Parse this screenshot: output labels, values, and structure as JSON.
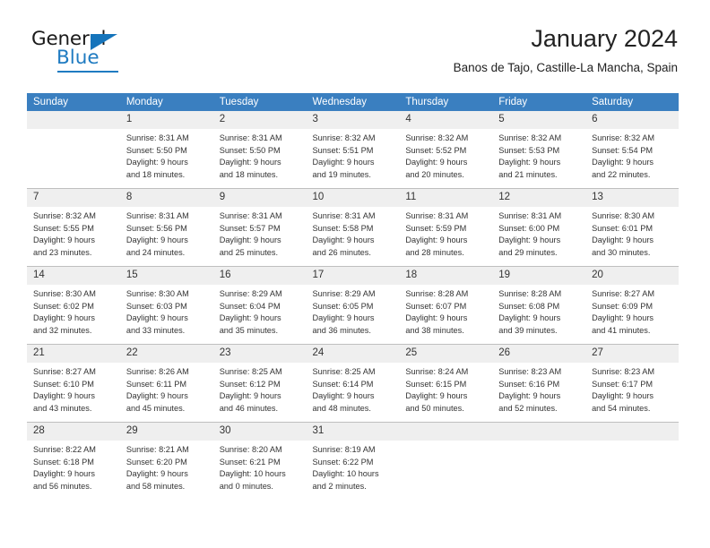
{
  "brand": {
    "name_dark": "General",
    "name_blue": "Blue",
    "accent_color": "#1f7bc1",
    "triangle_color": "#1574bb"
  },
  "header": {
    "title": "January 2024",
    "subtitle": "Banos de Tajo, Castille-La Mancha, Spain"
  },
  "calendar": {
    "header_bg": "#3a7fc0",
    "daynum_bg": "#efefef",
    "weekday_headers": [
      "Sunday",
      "Monday",
      "Tuesday",
      "Wednesday",
      "Thursday",
      "Friday",
      "Saturday"
    ],
    "weeks": [
      [
        {
          "day": "",
          "sunrise": "",
          "sunset": "",
          "daylight1": "",
          "daylight2": ""
        },
        {
          "day": "1",
          "sunrise": "Sunrise: 8:31 AM",
          "sunset": "Sunset: 5:50 PM",
          "daylight1": "Daylight: 9 hours",
          "daylight2": "and 18 minutes."
        },
        {
          "day": "2",
          "sunrise": "Sunrise: 8:31 AM",
          "sunset": "Sunset: 5:50 PM",
          "daylight1": "Daylight: 9 hours",
          "daylight2": "and 18 minutes."
        },
        {
          "day": "3",
          "sunrise": "Sunrise: 8:32 AM",
          "sunset": "Sunset: 5:51 PM",
          "daylight1": "Daylight: 9 hours",
          "daylight2": "and 19 minutes."
        },
        {
          "day": "4",
          "sunrise": "Sunrise: 8:32 AM",
          "sunset": "Sunset: 5:52 PM",
          "daylight1": "Daylight: 9 hours",
          "daylight2": "and 20 minutes."
        },
        {
          "day": "5",
          "sunrise": "Sunrise: 8:32 AM",
          "sunset": "Sunset: 5:53 PM",
          "daylight1": "Daylight: 9 hours",
          "daylight2": "and 21 minutes."
        },
        {
          "day": "6",
          "sunrise": "Sunrise: 8:32 AM",
          "sunset": "Sunset: 5:54 PM",
          "daylight1": "Daylight: 9 hours",
          "daylight2": "and 22 minutes."
        }
      ],
      [
        {
          "day": "7",
          "sunrise": "Sunrise: 8:32 AM",
          "sunset": "Sunset: 5:55 PM",
          "daylight1": "Daylight: 9 hours",
          "daylight2": "and 23 minutes."
        },
        {
          "day": "8",
          "sunrise": "Sunrise: 8:31 AM",
          "sunset": "Sunset: 5:56 PM",
          "daylight1": "Daylight: 9 hours",
          "daylight2": "and 24 minutes."
        },
        {
          "day": "9",
          "sunrise": "Sunrise: 8:31 AM",
          "sunset": "Sunset: 5:57 PM",
          "daylight1": "Daylight: 9 hours",
          "daylight2": "and 25 minutes."
        },
        {
          "day": "10",
          "sunrise": "Sunrise: 8:31 AM",
          "sunset": "Sunset: 5:58 PM",
          "daylight1": "Daylight: 9 hours",
          "daylight2": "and 26 minutes."
        },
        {
          "day": "11",
          "sunrise": "Sunrise: 8:31 AM",
          "sunset": "Sunset: 5:59 PM",
          "daylight1": "Daylight: 9 hours",
          "daylight2": "and 28 minutes."
        },
        {
          "day": "12",
          "sunrise": "Sunrise: 8:31 AM",
          "sunset": "Sunset: 6:00 PM",
          "daylight1": "Daylight: 9 hours",
          "daylight2": "and 29 minutes."
        },
        {
          "day": "13",
          "sunrise": "Sunrise: 8:30 AM",
          "sunset": "Sunset: 6:01 PM",
          "daylight1": "Daylight: 9 hours",
          "daylight2": "and 30 minutes."
        }
      ],
      [
        {
          "day": "14",
          "sunrise": "Sunrise: 8:30 AM",
          "sunset": "Sunset: 6:02 PM",
          "daylight1": "Daylight: 9 hours",
          "daylight2": "and 32 minutes."
        },
        {
          "day": "15",
          "sunrise": "Sunrise: 8:30 AM",
          "sunset": "Sunset: 6:03 PM",
          "daylight1": "Daylight: 9 hours",
          "daylight2": "and 33 minutes."
        },
        {
          "day": "16",
          "sunrise": "Sunrise: 8:29 AM",
          "sunset": "Sunset: 6:04 PM",
          "daylight1": "Daylight: 9 hours",
          "daylight2": "and 35 minutes."
        },
        {
          "day": "17",
          "sunrise": "Sunrise: 8:29 AM",
          "sunset": "Sunset: 6:05 PM",
          "daylight1": "Daylight: 9 hours",
          "daylight2": "and 36 minutes."
        },
        {
          "day": "18",
          "sunrise": "Sunrise: 8:28 AM",
          "sunset": "Sunset: 6:07 PM",
          "daylight1": "Daylight: 9 hours",
          "daylight2": "and 38 minutes."
        },
        {
          "day": "19",
          "sunrise": "Sunrise: 8:28 AM",
          "sunset": "Sunset: 6:08 PM",
          "daylight1": "Daylight: 9 hours",
          "daylight2": "and 39 minutes."
        },
        {
          "day": "20",
          "sunrise": "Sunrise: 8:27 AM",
          "sunset": "Sunset: 6:09 PM",
          "daylight1": "Daylight: 9 hours",
          "daylight2": "and 41 minutes."
        }
      ],
      [
        {
          "day": "21",
          "sunrise": "Sunrise: 8:27 AM",
          "sunset": "Sunset: 6:10 PM",
          "daylight1": "Daylight: 9 hours",
          "daylight2": "and 43 minutes."
        },
        {
          "day": "22",
          "sunrise": "Sunrise: 8:26 AM",
          "sunset": "Sunset: 6:11 PM",
          "daylight1": "Daylight: 9 hours",
          "daylight2": "and 45 minutes."
        },
        {
          "day": "23",
          "sunrise": "Sunrise: 8:25 AM",
          "sunset": "Sunset: 6:12 PM",
          "daylight1": "Daylight: 9 hours",
          "daylight2": "and 46 minutes."
        },
        {
          "day": "24",
          "sunrise": "Sunrise: 8:25 AM",
          "sunset": "Sunset: 6:14 PM",
          "daylight1": "Daylight: 9 hours",
          "daylight2": "and 48 minutes."
        },
        {
          "day": "25",
          "sunrise": "Sunrise: 8:24 AM",
          "sunset": "Sunset: 6:15 PM",
          "daylight1": "Daylight: 9 hours",
          "daylight2": "and 50 minutes."
        },
        {
          "day": "26",
          "sunrise": "Sunrise: 8:23 AM",
          "sunset": "Sunset: 6:16 PM",
          "daylight1": "Daylight: 9 hours",
          "daylight2": "and 52 minutes."
        },
        {
          "day": "27",
          "sunrise": "Sunrise: 8:23 AM",
          "sunset": "Sunset: 6:17 PM",
          "daylight1": "Daylight: 9 hours",
          "daylight2": "and 54 minutes."
        }
      ],
      [
        {
          "day": "28",
          "sunrise": "Sunrise: 8:22 AM",
          "sunset": "Sunset: 6:18 PM",
          "daylight1": "Daylight: 9 hours",
          "daylight2": "and 56 minutes."
        },
        {
          "day": "29",
          "sunrise": "Sunrise: 8:21 AM",
          "sunset": "Sunset: 6:20 PM",
          "daylight1": "Daylight: 9 hours",
          "daylight2": "and 58 minutes."
        },
        {
          "day": "30",
          "sunrise": "Sunrise: 8:20 AM",
          "sunset": "Sunset: 6:21 PM",
          "daylight1": "Daylight: 10 hours",
          "daylight2": "and 0 minutes."
        },
        {
          "day": "31",
          "sunrise": "Sunrise: 8:19 AM",
          "sunset": "Sunset: 6:22 PM",
          "daylight1": "Daylight: 10 hours",
          "daylight2": "and 2 minutes."
        },
        {
          "day": "",
          "sunrise": "",
          "sunset": "",
          "daylight1": "",
          "daylight2": ""
        },
        {
          "day": "",
          "sunrise": "",
          "sunset": "",
          "daylight1": "",
          "daylight2": ""
        },
        {
          "day": "",
          "sunrise": "",
          "sunset": "",
          "daylight1": "",
          "daylight2": ""
        }
      ]
    ]
  }
}
